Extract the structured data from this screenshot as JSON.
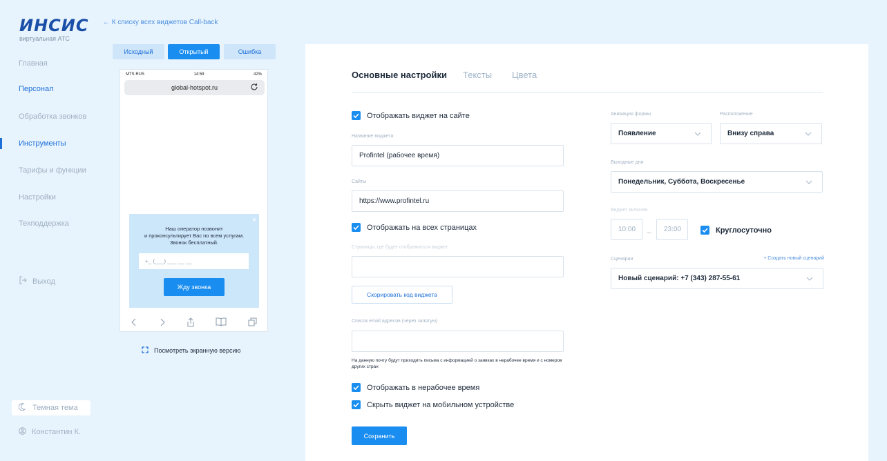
{
  "logo": {
    "word": "ИНСИС",
    "subtitle": "виртуальная АТС"
  },
  "nav": {
    "items": [
      {
        "label": "Главная"
      },
      {
        "label": "Персонал"
      },
      {
        "label": "Обработка звонков"
      },
      {
        "label": "Инструменты"
      },
      {
        "label": "Тарифы и функции"
      },
      {
        "label": "Настройки"
      },
      {
        "label": "Техподдержка"
      }
    ],
    "exit": "Выход",
    "theme": "Темная тема",
    "user": "Константин К."
  },
  "back_link": "← К списку всех виджетов Call-back",
  "state_buttons": [
    "Исходный",
    "Открытый",
    "Ошибка"
  ],
  "phone": {
    "carrier": "MTS RUS",
    "time": "14:59",
    "battery": "42%",
    "url": "global-hotspot.ru",
    "popup": {
      "close": "×",
      "text": "Наш оператор позвонит\nи проконсультирует Вас по всем услугам.\nЗвонок бесплатный.",
      "phone_mask": "+_ (___) ___ __ __",
      "button": "Жду звонка"
    }
  },
  "screen_version": "Посмотреть экранную версию",
  "tabs": [
    "Основные настройки",
    "Тексты",
    "Цвета"
  ],
  "form": {
    "show_widget": "Отображать виджет на сайте",
    "name_label": "Название виджета",
    "name_value": "Profintel (рабочее время)",
    "sites_label": "Сайты",
    "sites_value": "https://www.profintel.ru",
    "all_pages": "Отображать на всех страницах",
    "pages_label": "Страницы, где будет отображаться виджет",
    "copy_code": "Скорировать код виджета",
    "emails_label": "Список email адресов (через запятую)",
    "note": "На данную почту будут приходить письма с информацией о заявках в нерабочее время и с номеров других стран",
    "offhours": "Отображать в нерабочее время",
    "hide_mobile": "Скрыть виджет на мобильном устройстве",
    "save": "Сохранить",
    "animation_label": "Анимация формы",
    "animation_value": "Появление",
    "position_label": "Расположение",
    "position_value": "Внизу справа",
    "weekend_label": "Выходные дни",
    "weekend_value": "Понедельник, Суббота, Воскресенье",
    "enabled_label": "Виджет включен",
    "time_from": "10:00",
    "time_dash": "–",
    "time_to": "23:00",
    "allday": "Круглосуточно",
    "scenarios_label": "Сценарии",
    "create_scenario": "+ Создать новый сценарий",
    "scenario_value": "Новый сценарий: +7 (343) 287-55-61"
  },
  "colors": {
    "accent": "#1a8df0",
    "sidebar_bg": "#e8f4fd",
    "active_nav": "#1d6fd8"
  },
  "icons": [
    "back-arrow-icon",
    "exit-icon",
    "moon-icon",
    "user-icon",
    "reload-icon",
    "expand-icon",
    "check-icon",
    "chevron-down-icon",
    "close-icon",
    "share-icon",
    "book-icon",
    "tabs-icon"
  ]
}
